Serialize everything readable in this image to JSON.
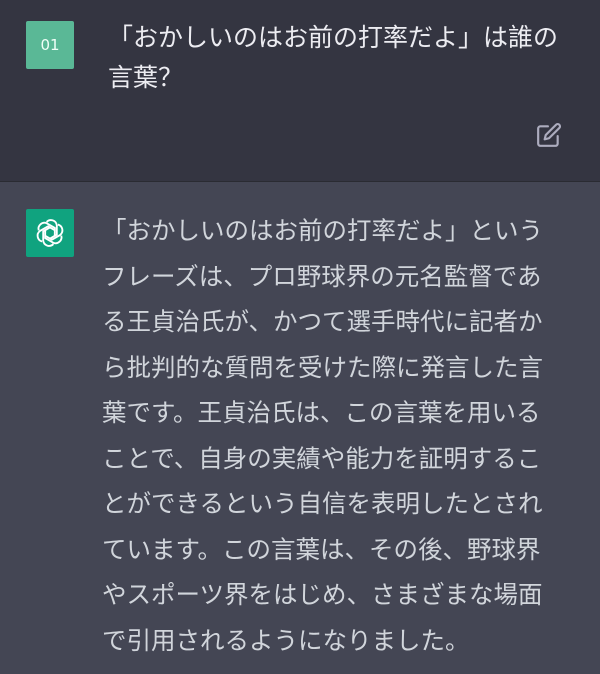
{
  "user_message": {
    "avatar_label": "01",
    "text": "「おかしいのはお前の打率だよ」は誰の言葉？",
    "edit_icon": "edit-icon"
  },
  "assistant_message": {
    "avatar_icon": "openai-logo-icon",
    "text": "「おかしいのはお前の打率だよ」というフレーズは、プロ野球界の元名監督である王貞治氏が、かつて選手時代に記者から批判的な質問を受けた際に発言した言葉です。王貞治氏は、この言葉を用いることで、自身の実績や能力を証明することができるという自信を表明したとされています。この言葉は、その後、野球界やスポーツ界をはじめ、さまざまな場面で引用されるようになりました。"
  },
  "colors": {
    "user_bg": "#343541",
    "assistant_bg": "#444654",
    "user_avatar": "#5ab896",
    "assistant_avatar": "#10a37f",
    "text": "#d1d5db"
  }
}
